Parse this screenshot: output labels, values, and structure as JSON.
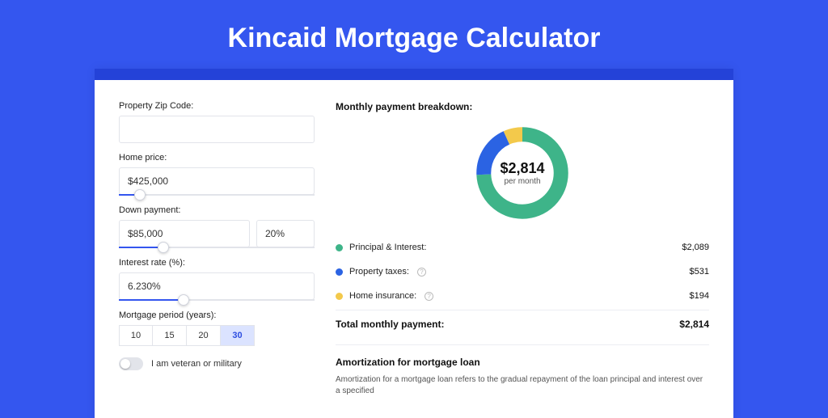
{
  "title": "Kincaid Mortgage Calculator",
  "form": {
    "zip": {
      "label": "Property Zip Code:",
      "value": ""
    },
    "price": {
      "label": "Home price:",
      "value": "$425,000",
      "slider_pct": 8
    },
    "down": {
      "label": "Down payment:",
      "value": "$85,000",
      "pct": "20%",
      "slider_pct": 20
    },
    "rate": {
      "label": "Interest rate (%):",
      "value": "6.230%",
      "slider_pct": 30
    },
    "period": {
      "label": "Mortgage period (years):",
      "options": [
        "10",
        "15",
        "20",
        "30"
      ],
      "selected": "30"
    },
    "veteran": {
      "label": "I am veteran or military",
      "on": false
    }
  },
  "breakdown": {
    "title": "Monthly payment breakdown:",
    "center_amount": "$2,814",
    "center_sub": "per month",
    "rows": [
      {
        "label": "Principal & Interest:",
        "value": "$2,089",
        "color": "#3eb489"
      },
      {
        "label": "Property taxes:",
        "value": "$531",
        "color": "#2b63e3",
        "info": true
      },
      {
        "label": "Home insurance:",
        "value": "$194",
        "color": "#f3c94b",
        "info": true
      }
    ],
    "total_label": "Total monthly payment:",
    "total_value": "$2,814"
  },
  "amort": {
    "title": "Amortization for mortgage loan",
    "body": "Amortization for a mortgage loan refers to the gradual repayment of the loan principal and interest over a specified"
  },
  "chart_data": {
    "type": "pie",
    "title": "Monthly payment breakdown",
    "series": [
      {
        "name": "Principal & Interest",
        "value": 2089,
        "color": "#3eb489"
      },
      {
        "name": "Property taxes",
        "value": 531,
        "color": "#2b63e3"
      },
      {
        "name": "Home insurance",
        "value": 194,
        "color": "#f3c94b"
      }
    ],
    "total": 2814,
    "center_label": "$2,814 per month"
  }
}
